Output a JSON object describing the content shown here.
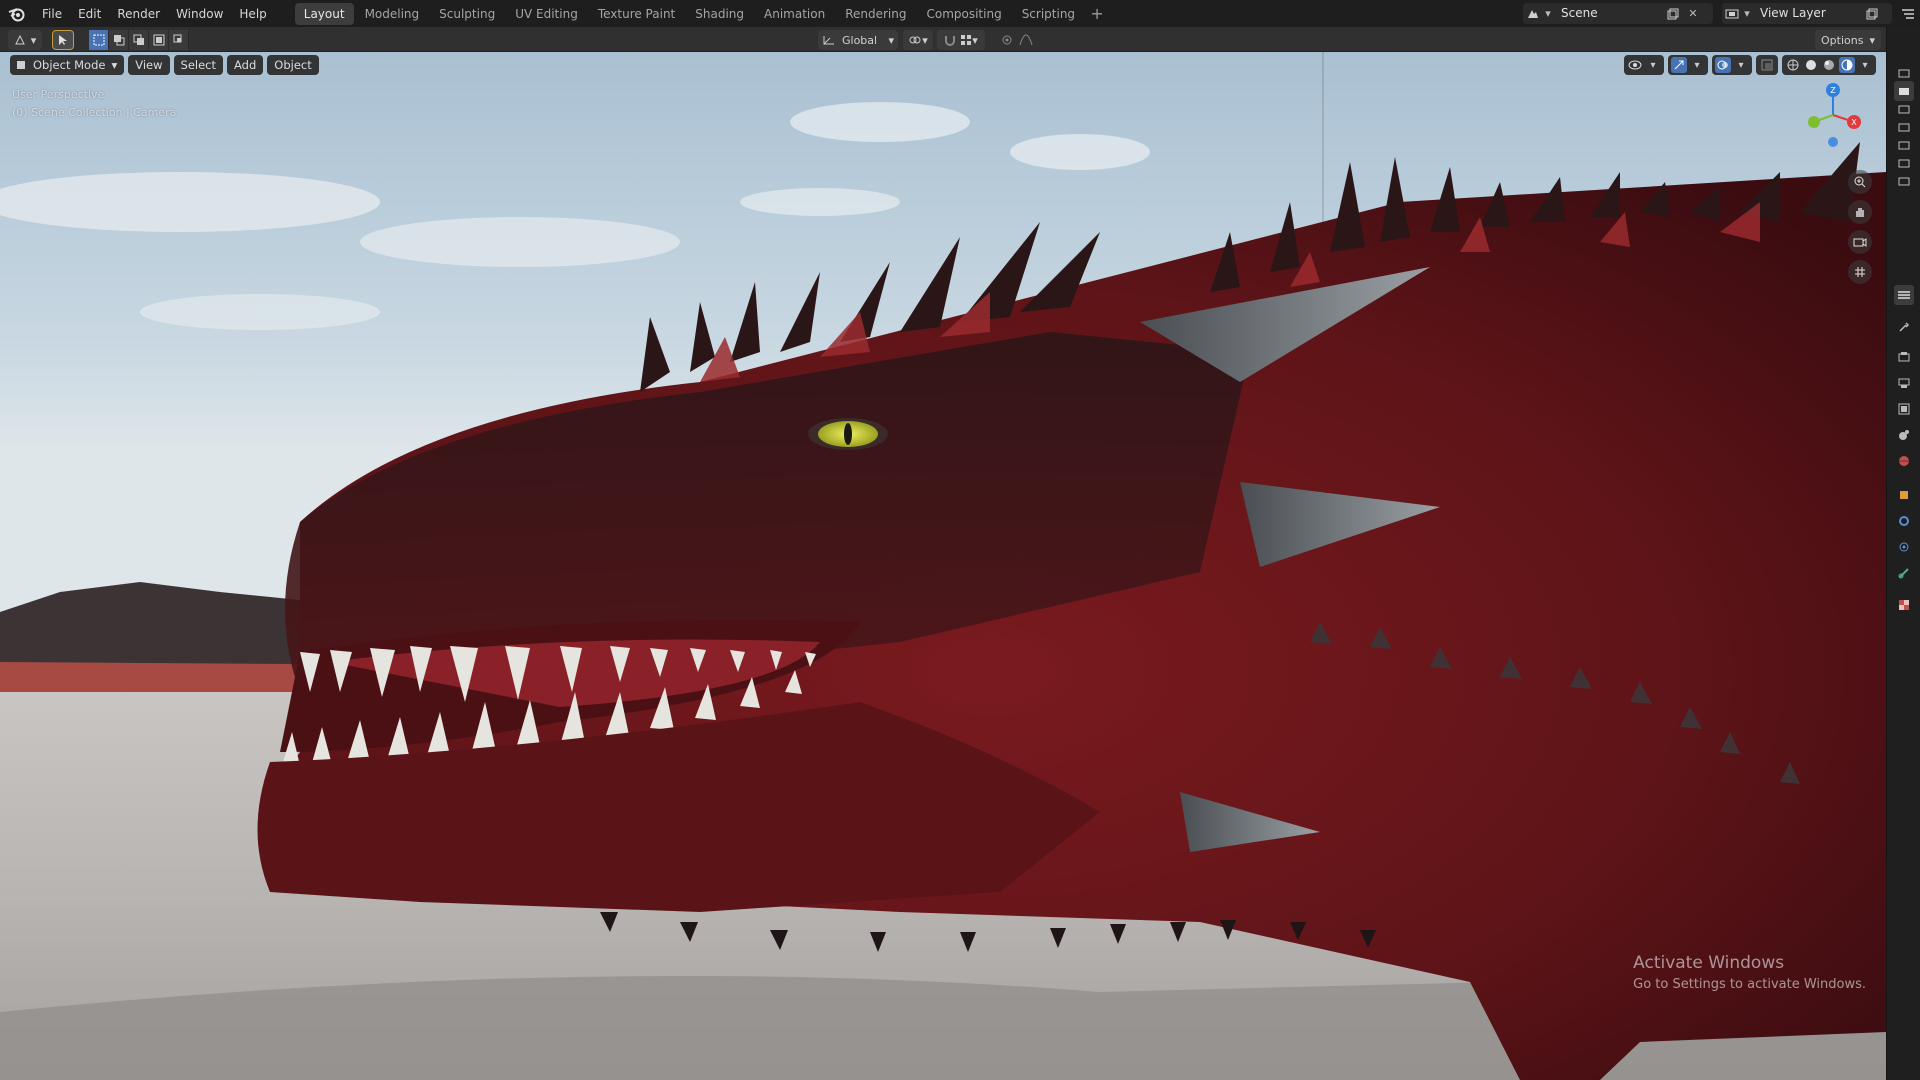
{
  "app": {
    "menu": [
      "File",
      "Edit",
      "Render",
      "Window",
      "Help"
    ],
    "workspaces": [
      "Layout",
      "Modeling",
      "Sculpting",
      "UV Editing",
      "Texture Paint",
      "Shading",
      "Animation",
      "Rendering",
      "Compositing",
      "Scripting"
    ],
    "active_workspace": "Layout",
    "scene_name": "Scene",
    "view_layer_name": "View Layer"
  },
  "header": {
    "transform_orientation": "Global",
    "options_label": "Options"
  },
  "viewport": {
    "mode": "Object Mode",
    "menu": [
      "View",
      "Select",
      "Add",
      "Object"
    ],
    "overlay_line1": "User Perspective",
    "overlay_line2": "(0) Scene Collection | Camera",
    "gizmo_axes": {
      "z": "Z",
      "x": "X"
    }
  },
  "watermark": {
    "title": "Activate Windows",
    "subtitle": "Go to Settings to activate Windows."
  },
  "icons": {
    "logo": "blender-logo-icon",
    "colors": {
      "accent": "#4772b3",
      "x_axis": "#e23b3b",
      "y_axis": "#7ebf30",
      "z_axis": "#2d7fe0"
    }
  }
}
